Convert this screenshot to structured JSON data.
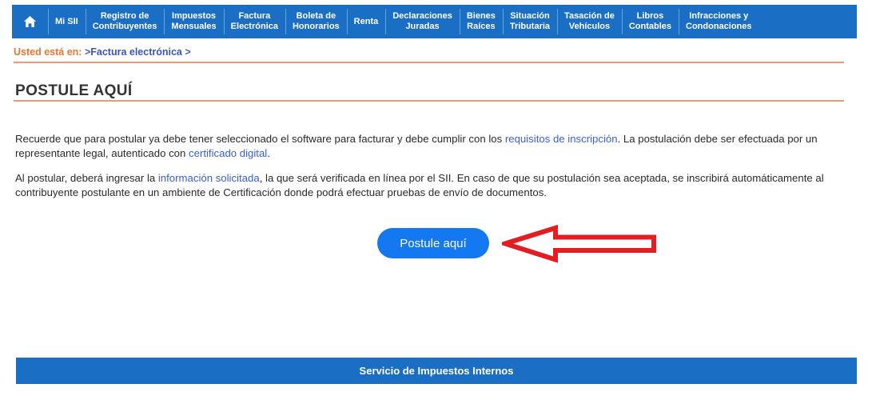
{
  "nav": {
    "home_icon": "home-icon",
    "items": [
      {
        "label": "Mi SII"
      },
      {
        "label": "Registro de\nContribuyentes"
      },
      {
        "label": "Impuestos\nMensuales"
      },
      {
        "label": "Factura\nElectrónica"
      },
      {
        "label": "Boleta de\nHonorarios"
      },
      {
        "label": "Renta"
      },
      {
        "label": "Declaraciones\nJuradas"
      },
      {
        "label": "Bienes\nRaíces"
      },
      {
        "label": "Situación\nTributaria"
      },
      {
        "label": "Tasación de\nVehículos"
      },
      {
        "label": "Libros\nContables"
      },
      {
        "label": "Infracciones y\nCondonaciones"
      }
    ],
    "background_color": "#1a6fc4",
    "divider_color": "#5fa3dd"
  },
  "breadcrumb": {
    "prefix": "Usted está en:",
    "separator_before": ">",
    "link": "Factura electrónica",
    "separator_after": ">",
    "prefix_color": "#e8762c",
    "link_color": "#3a55b8"
  },
  "page_title": "POSTULE AQUÍ",
  "rules_color": "#f2996a",
  "paragraphs": {
    "p1": {
      "part1": "Recuerde que para postular ya debe tener seleccionado el software para facturar y debe cumplir con los ",
      "link1": "requisitos de inscripción",
      "part2": ". La postulación debe ser efectuada por un representante legal, autenticado con ",
      "link2": "certificado digital",
      "part3": "."
    },
    "p2": {
      "part1": "Al postular, deberá ingresar la ",
      "link1": "información solicitada",
      "part2": ", la que será verificada en línea por el SII. En caso de que su postulación sea aceptada, se inscribirá automáticamente al contribuyente postulante en un ambiente de Certificación donde podrá efectuar pruebas de envío de documentos."
    },
    "link_color": "#3b5fd0"
  },
  "cta": {
    "label": "Postule aquí",
    "background_color": "#1478f0",
    "text_color": "#ffffff"
  },
  "annotation": {
    "arrow_icon": "left-arrow-icon",
    "arrow_color": "#e41d22",
    "direction": "left"
  },
  "footer": {
    "text": "Servicio de Impuestos Internos",
    "background_color": "#1a6fc4"
  }
}
